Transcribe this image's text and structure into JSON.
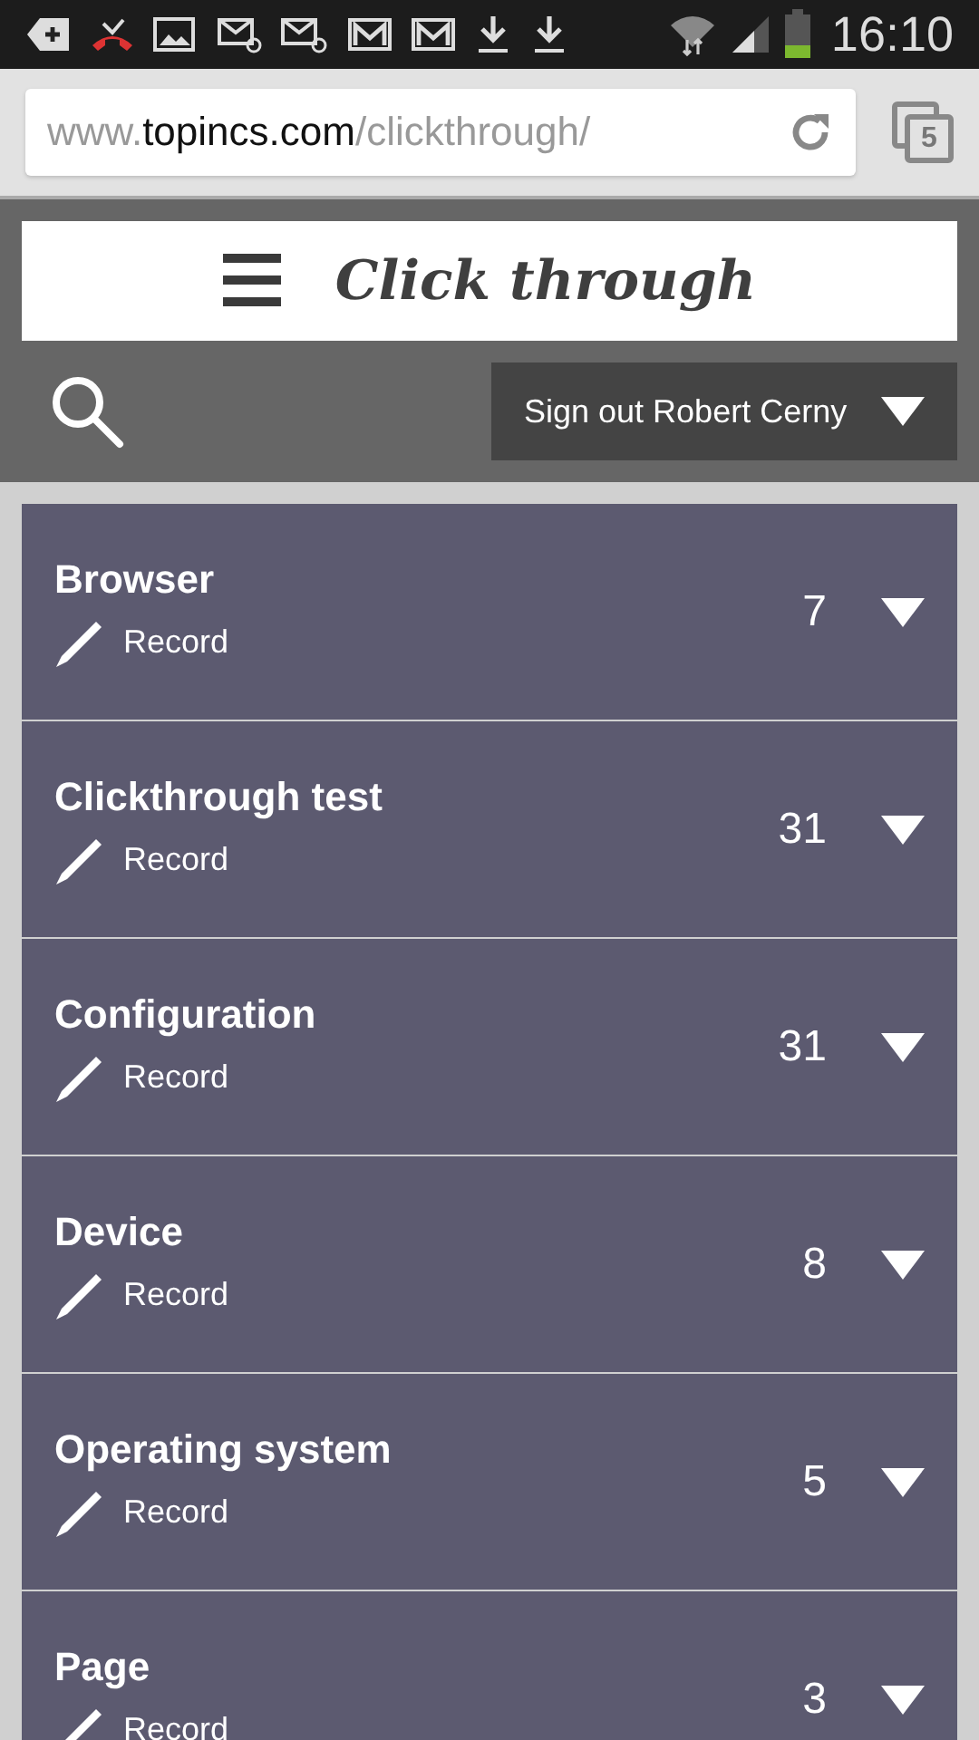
{
  "status_bar": {
    "time": "16:10"
  },
  "browser": {
    "url_prefix": "www.",
    "url_domain": "topincs.com",
    "url_path": "/clickthrough/",
    "tab_count": "5"
  },
  "header": {
    "title": "Click through",
    "sign_out": "Sign out Robert Cerny"
  },
  "items": [
    {
      "title": "Browser",
      "action": "Record",
      "count": "7"
    },
    {
      "title": "Clickthrough test",
      "action": "Record",
      "count": "31"
    },
    {
      "title": "Configuration",
      "action": "Record",
      "count": "31"
    },
    {
      "title": "Device",
      "action": "Record",
      "count": "8"
    },
    {
      "title": "Operating system",
      "action": "Record",
      "count": "5"
    },
    {
      "title": "Page",
      "action": "Record",
      "count": "3"
    }
  ]
}
